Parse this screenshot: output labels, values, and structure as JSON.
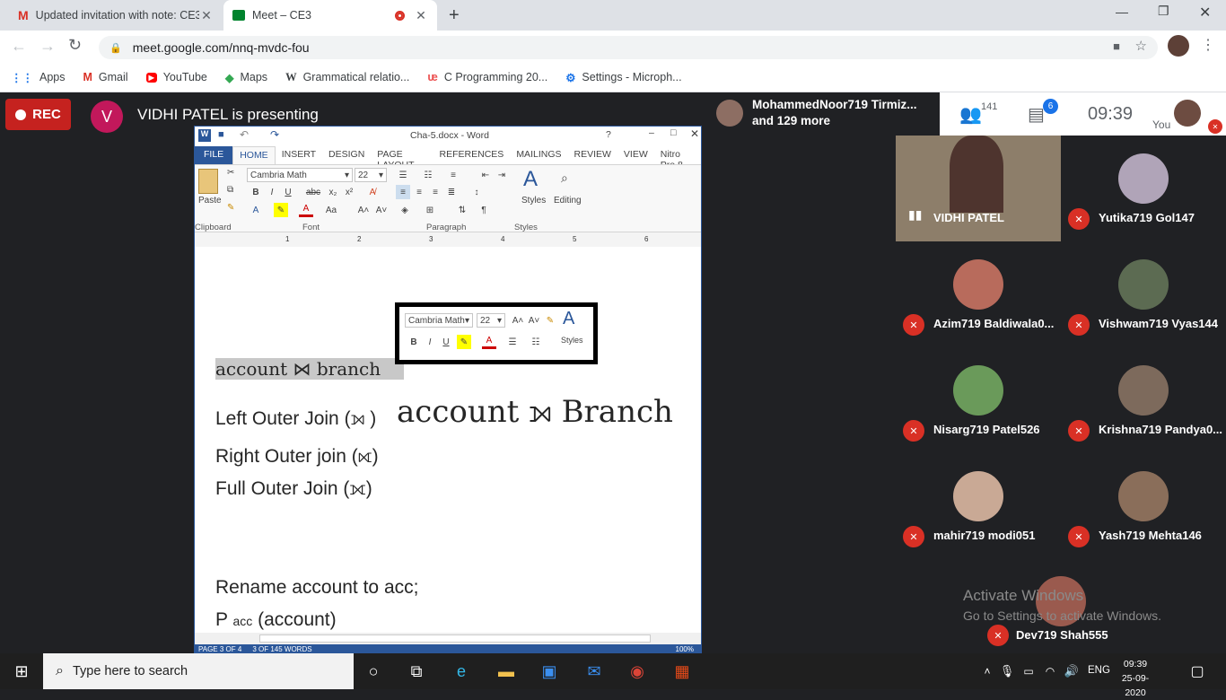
{
  "browser": {
    "tabs": [
      {
        "title": "Updated invitation with note: CE3",
        "favicon": "gmail-icon"
      },
      {
        "title": "Meet – CE3",
        "favicon": "meet-icon"
      }
    ],
    "new_tab_label": "+",
    "url": "meet.google.com/nnq-mvdc-fou",
    "bookmarks": [
      {
        "label": "Apps",
        "icon": "apps-icon"
      },
      {
        "label": "Gmail",
        "icon": "gmail-icon"
      },
      {
        "label": "YouTube",
        "icon": "youtube-icon"
      },
      {
        "label": "Maps",
        "icon": "maps-icon"
      },
      {
        "label": "Grammatical relatio...",
        "icon": "wikipedia-icon"
      },
      {
        "label": "C Programming 20...",
        "icon": "udemy-icon"
      },
      {
        "label": "Settings - Microph...",
        "icon": "settings-gear-icon"
      }
    ]
  },
  "meet": {
    "rec_label": "REC",
    "presenter_initial": "V",
    "presenting_text": "VIDHI PATEL is presenting",
    "call_names_line1": "MohammedNoor719 Tirmiz...",
    "call_names_line2": "and 129 more",
    "people_count": "141",
    "chat_badge": "6",
    "time": "09:39",
    "you_label": "You",
    "participants": [
      {
        "name": "VIDHI PATEL",
        "muted": false,
        "video": true
      },
      {
        "name": "Yutika719 Gol147",
        "muted": true
      },
      {
        "name": "Azim719 Baldiwala0...",
        "muted": true
      },
      {
        "name": "Vishwam719 Vyas144",
        "muted": true
      },
      {
        "name": "Nisarg719 Patel526",
        "muted": true
      },
      {
        "name": "Krishna719 Pandya0...",
        "muted": true
      },
      {
        "name": "mahir719 modi051",
        "muted": true
      },
      {
        "name": "Yash719 Mehta146",
        "muted": true
      },
      {
        "name": "Dev719 Shah555",
        "muted": true
      }
    ],
    "watermark_line1": "Activate Windows",
    "watermark_line2": "Go to Settings to activate Windows."
  },
  "word": {
    "title": "Cha-5.docx - Word",
    "help": "?",
    "ribbon_tabs": [
      "FILE",
      "HOME",
      "INSERT",
      "DESIGN",
      "PAGE LAYOUT",
      "REFERENCES",
      "MAILINGS",
      "REVIEW",
      "VIEW",
      "Nitro Pro 8"
    ],
    "active_tab": "HOME",
    "font_name": "Cambria Math",
    "font_size": "22",
    "groups": {
      "clipboard": "Clipboard",
      "font": "Font",
      "paragraph": "Paragraph",
      "styles": "Styles"
    },
    "paste_label": "Paste",
    "styles_label": "Styles",
    "editing_label": "Editing",
    "mini_font": "Cambria Math",
    "mini_size": "22",
    "mini_styles": "Styles",
    "ruler_numbers": [
      "1",
      "2",
      "3",
      "4",
      "5",
      "6"
    ],
    "lines": {
      "l1": "account ⋈ branch",
      "l2a": "Left Outer Join (⟕ )",
      "l2b": "account ⟕ Branch",
      "l3": "Right Outer join (⟖)",
      "l4": "Full Outer Join (⟗)",
      "l5": "Rename account to acc;",
      "l6a": "P ",
      "l6b": "acc",
      "l6c": " (account)"
    },
    "status_page": "PAGE 3 OF 4",
    "status_words": "3 OF 145 WORDS",
    "zoom": "100%"
  },
  "taskbar": {
    "search_placeholder": "Type here to search",
    "lang": "ENG",
    "time": "09:39",
    "date": "25-09-2020"
  },
  "colors": {
    "rec": "#c5221f",
    "word_blue": "#2b579a",
    "muted_red": "#d93025",
    "meet_bg": "#202124"
  }
}
